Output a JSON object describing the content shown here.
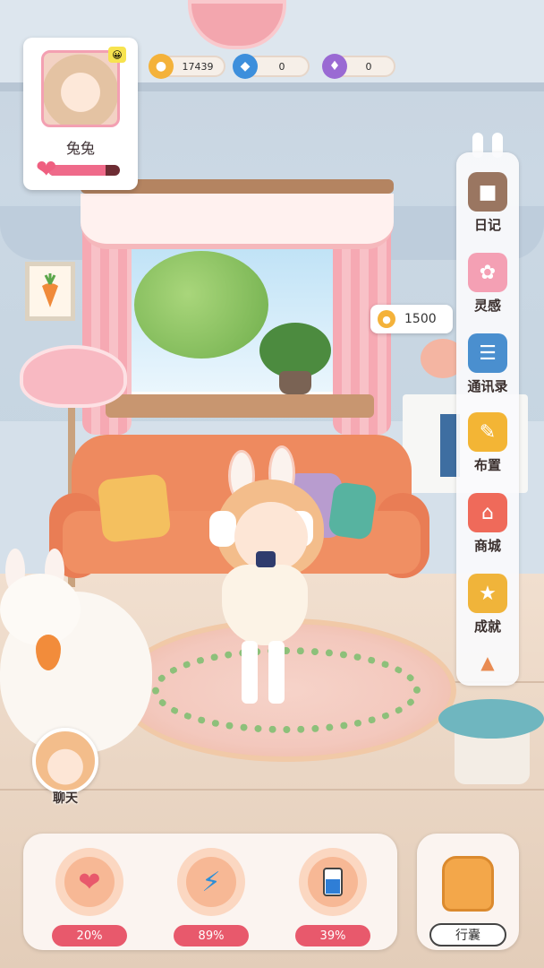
{
  "profile": {
    "name": "兔兔",
    "affection_level": 0.8,
    "emoji": "😀"
  },
  "resources": [
    {
      "icon": "carrot-coin-icon",
      "value": "17439",
      "color": "#f4b23a"
    },
    {
      "icon": "diamond-gem-icon",
      "value": "0",
      "color": "#3d8fdc"
    },
    {
      "icon": "purple-crystal-icon",
      "value": "0",
      "color": "#9a6ad3"
    }
  ],
  "coin_bubble": {
    "value": "1500"
  },
  "side_menu": {
    "items": [
      {
        "label": "日记",
        "icon": "diary-book-icon",
        "color": "#9a7661"
      },
      {
        "label": "灵感",
        "icon": "bunny-inspiration-icon",
        "color": "#f4a0b4"
      },
      {
        "label": "通讯录",
        "icon": "contacts-book-icon",
        "color": "#4a8fcf"
      },
      {
        "label": "布置",
        "icon": "paint-brush-icon",
        "color": "#f3b535"
      },
      {
        "label": "商城",
        "icon": "shop-stall-icon",
        "color": "#ef6a5a"
      },
      {
        "label": "成就",
        "icon": "trophy-medal-icon",
        "color": "#f0b43a"
      }
    ],
    "collapse_icon": "arrow-up-icon"
  },
  "chat": {
    "label": "聊天"
  },
  "stats": [
    {
      "icon": "heart-icon",
      "percent": "20%",
      "symbol": "❤",
      "color": "#e8596c"
    },
    {
      "icon": "lightning-energy-icon",
      "percent": "89%",
      "symbol": "⚡",
      "color": "#2f8fd6"
    },
    {
      "icon": "water-cup-icon",
      "percent": "39%",
      "symbol": "▮",
      "color": "#2f7ed6"
    }
  ],
  "bag": {
    "label": "行囊",
    "icon": "backpack-icon"
  }
}
